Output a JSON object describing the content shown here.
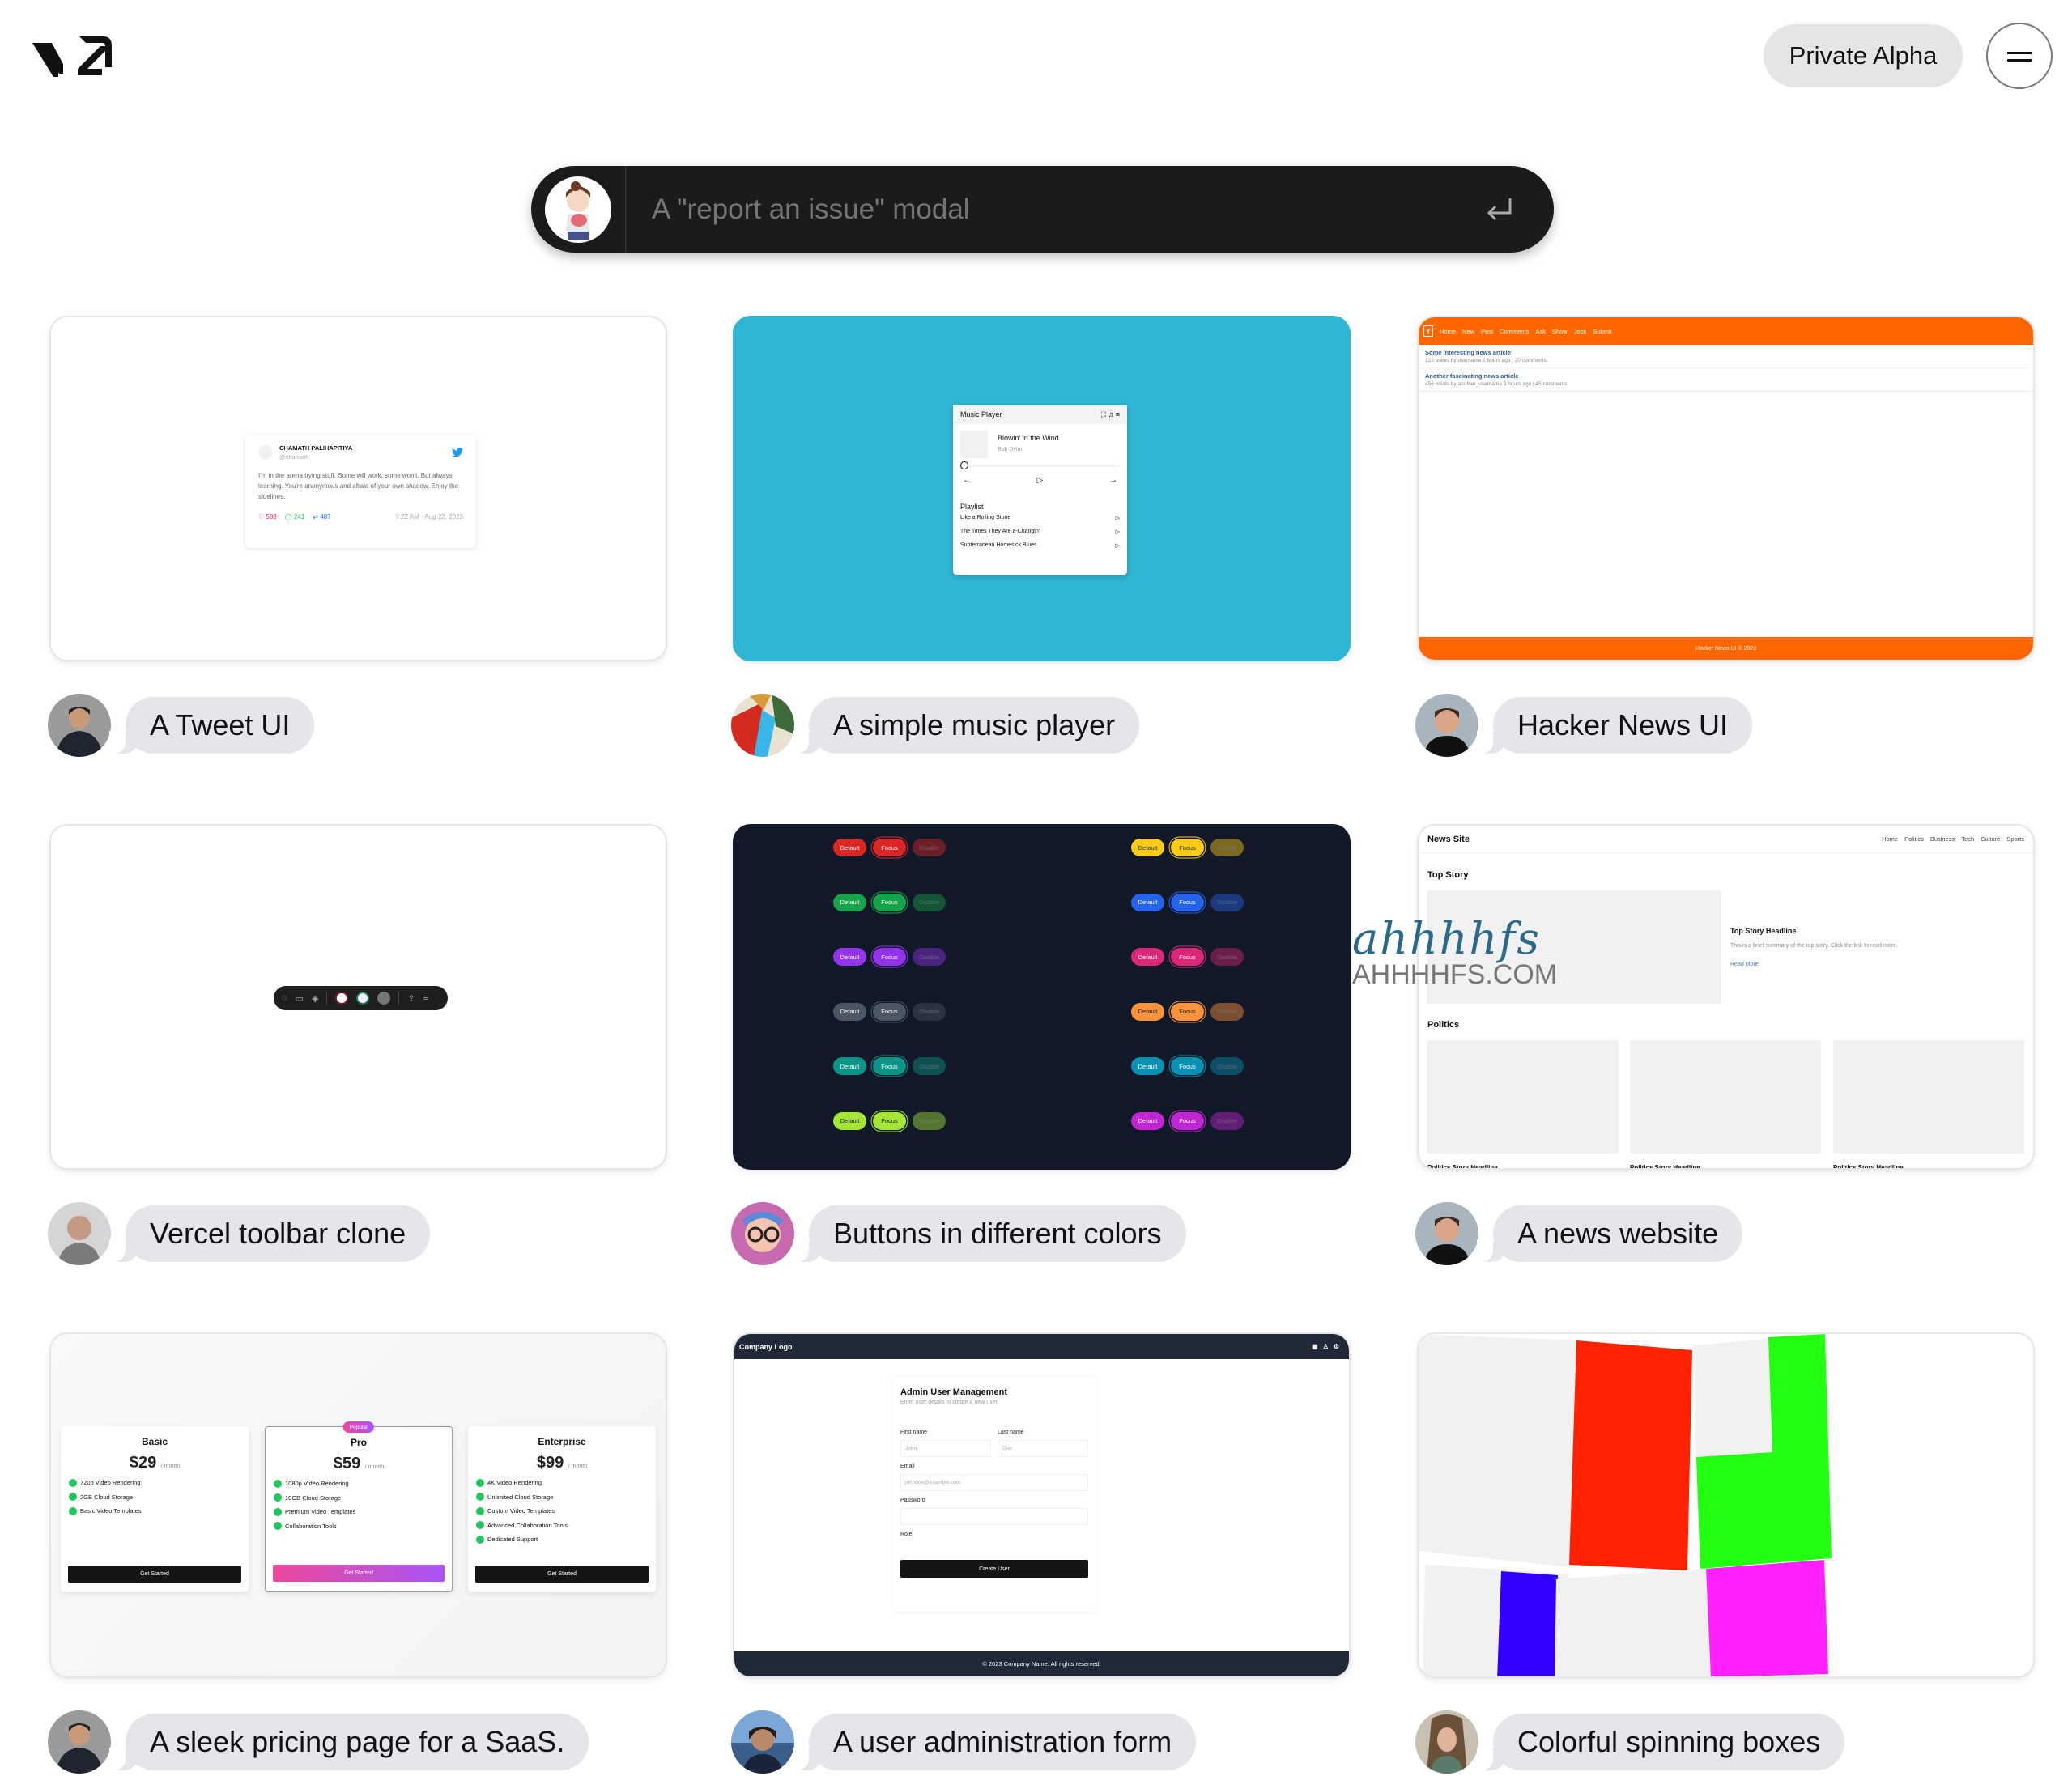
{
  "header": {
    "logo_text": "v0",
    "private_alpha_label": "Private Alpha",
    "menu_icon": "hamburger-icon"
  },
  "prompt": {
    "placeholder": "A \"report an issue\" modal",
    "submit_icon": "enter-icon"
  },
  "cards": [
    {
      "label": "A Tweet UI",
      "preview": {
        "type": "tweet",
        "name": "CHAMATH PALIHAPITIYA",
        "handle": "@chamath",
        "text": "I'm in the arena trying stuff. Some will work, some won't. But always learning. You're anonymous and afraid of your own shadow. Enjoy the sidelines.",
        "likes": "588",
        "replies": "241",
        "retweets": "487",
        "timestamp": "7:22 AM · Aug 22, 2023"
      }
    },
    {
      "label": "A simple music player",
      "preview": {
        "type": "music",
        "title": "Music Player",
        "song": "Blowin' in the Wind",
        "artist": "Bob Dylan",
        "playlist_title": "Playlist",
        "playlist": [
          "Like a Rolling Stone",
          "The Times They Are a-Changin'",
          "Subterranean Homesick Blues"
        ],
        "bg_color": "#2fb6d4"
      }
    },
    {
      "label": "Hacker News UI",
      "preview": {
        "type": "hn",
        "logo": "Y",
        "nav": [
          "Home",
          "New",
          "Past",
          "Comments",
          "Ask",
          "Show",
          "Jobs",
          "Submit"
        ],
        "items": [
          {
            "title": "Some interesting news article",
            "meta": "123 points by username 2 hours ago | 20 comments"
          },
          {
            "title": "Another fascinating news article",
            "meta": "456 points by another_username 3 hours ago | 45 comments"
          }
        ],
        "footer": "Hacker News UI © 2023",
        "accent": "#ff6600"
      }
    },
    {
      "label": "Vercel toolbar clone",
      "preview": {
        "type": "toolbar"
      }
    },
    {
      "label": "Buttons in different colors",
      "preview": {
        "type": "buttons",
        "states": [
          "Default",
          "Focus",
          "Disable"
        ],
        "left_colors": [
          "#dc2626",
          "#16a34a",
          "#9333ea",
          "#4b5563",
          "#0d9488",
          "#a3e635"
        ],
        "right_colors": [
          "#facc15",
          "#2563eb",
          "#db2777",
          "#fb923c",
          "#0891b2",
          "#c026d3"
        ]
      }
    },
    {
      "label": "A news website",
      "preview": {
        "type": "news",
        "brand": "News Site",
        "nav": [
          "Home",
          "Politics",
          "Business",
          "Tech",
          "Culture",
          "Sports"
        ],
        "top_story_section": "Top Story",
        "top_headline": "Top Story Headline",
        "top_summary": "This is a brief summary of the top story. Click the link to read more.",
        "read_more": "Read More",
        "politics_section": "Politics",
        "politics_headline": "Politics Story Headline"
      }
    },
    {
      "label": "A sleek pricing page for a SaaS.",
      "preview": {
        "type": "pricing",
        "popular_badge": "Popular",
        "per": "/ month",
        "cta": "Get Started",
        "plans": [
          {
            "name": "Basic",
            "price": "$29",
            "features": [
              "720p Video Rendering",
              "2GB Cloud Storage",
              "Basic Video Templates"
            ]
          },
          {
            "name": "Pro",
            "price": "$59",
            "features": [
              "1080p Video Rendering",
              "10GB Cloud Storage",
              "Premium Video Templates",
              "Collaboration Tools"
            ]
          },
          {
            "name": "Enterprise",
            "price": "$99",
            "features": [
              "4K Video Rendering",
              "Unlimited Cloud Storage",
              "Custom Video Templates",
              "Advanced Collaboration Tools",
              "Dedicated Support"
            ]
          }
        ]
      }
    },
    {
      "label": "A user administration form",
      "preview": {
        "type": "admin",
        "brand": "Company Logo",
        "title": "Admin User Management",
        "subtitle": "Enter user details to create a new user",
        "first_name_label": "First name",
        "first_name_placeholder": "John",
        "last_name_label": "Last name",
        "last_name_placeholder": "Doe",
        "email_label": "Email",
        "email_placeholder": "johndoe@example.com",
        "password_label": "Password",
        "role_label": "Role",
        "submit": "Create User",
        "footer": "© 2023 Company Name. All rights reserved."
      }
    },
    {
      "label": "Colorful spinning boxes",
      "preview": {
        "type": "boxes",
        "colors": [
          "#ff2200",
          "#22ff11",
          "#3300ff",
          "#ff22ff"
        ]
      }
    }
  ],
  "watermark": {
    "text": "ahhhhfs",
    "domain": "AHHHHFS.COM"
  }
}
